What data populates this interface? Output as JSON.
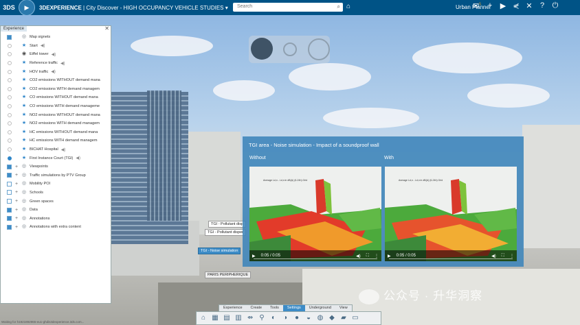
{
  "app": {
    "brand": "3DEXPERIENCE",
    "title_sep": " | ",
    "title": "City Discover - HIGH OCCUPANCY VEHICLE STUDIES",
    "title_chevron": "▾"
  },
  "search": {
    "placeholder": "Search"
  },
  "user": {
    "name": "Urban Planner"
  },
  "notification_count": "5",
  "top_icons": [
    "notification-icon",
    "add-icon",
    "play-icon",
    "share-icon",
    "tools-icon",
    "help-icon",
    "power-icon"
  ],
  "panel": {
    "tab_label": "Experience",
    "rows": [
      {
        "label": "Map signets",
        "check": "on",
        "expander": "",
        "icon": "layer",
        "sound": false
      },
      {
        "label": "Start",
        "check": "radio",
        "expander": "",
        "icon": "star",
        "sound": true
      },
      {
        "label": "Eiffel tower",
        "check": "radio",
        "expander": "",
        "icon": "eye",
        "sound": true
      },
      {
        "label": "Reference traffic",
        "check": "radio",
        "expander": "",
        "icon": "star",
        "sound": true
      },
      {
        "label": "HOV traffic",
        "check": "radio",
        "expander": "",
        "icon": "star",
        "sound": true
      },
      {
        "label": "CO2 emissions WITHOUT demand mana",
        "check": "radio",
        "expander": "",
        "icon": "star",
        "sound": false
      },
      {
        "label": "CO2 emissions WITH demand managem",
        "check": "radio",
        "expander": "",
        "icon": "star",
        "sound": false
      },
      {
        "label": "CO emissions WITHOUT demand mana",
        "check": "radio",
        "expander": "",
        "icon": "star",
        "sound": false
      },
      {
        "label": "CO emissions WITH demand manageme",
        "check": "radio",
        "expander": "",
        "icon": "star",
        "sound": false
      },
      {
        "label": "NO2 emissions WITHOUT demand mana",
        "check": "radio",
        "expander": "",
        "icon": "star",
        "sound": false
      },
      {
        "label": "NO2 emissions WITH demand managem",
        "check": "radio",
        "expander": "",
        "icon": "star",
        "sound": false
      },
      {
        "label": "HC emissions WITHOUT demand mana",
        "check": "radio",
        "expander": "",
        "icon": "star",
        "sound": false
      },
      {
        "label": "HC emissions WITH demand managem",
        "check": "radio",
        "expander": "",
        "icon": "star",
        "sound": false
      },
      {
        "label": "BICHAT Hospital",
        "check": "radio",
        "expander": "",
        "icon": "star",
        "sound": true
      },
      {
        "label": "First Instance Court (TGI)",
        "check": "radio-on",
        "expander": "",
        "icon": "star",
        "sound": true
      },
      {
        "label": "Viewpoints",
        "check": "on",
        "expander": "+",
        "icon": "layer",
        "sound": false
      },
      {
        "label": "Traffic simulations by PTV Group",
        "check": "on",
        "expander": "+",
        "icon": "layer",
        "sound": false
      },
      {
        "label": "Mobility POI",
        "check": "off",
        "expander": "+",
        "icon": "layer",
        "sound": false
      },
      {
        "label": "Schools",
        "check": "off",
        "expander": "+",
        "icon": "layer",
        "sound": false
      },
      {
        "label": "Green spaces",
        "check": "off",
        "expander": "+",
        "icon": "layer",
        "sound": false
      },
      {
        "label": "Data",
        "check": "on",
        "expander": "+",
        "icon": "layer",
        "sound": false
      },
      {
        "label": "Annotations",
        "check": "on",
        "expander": "+",
        "icon": "layer",
        "sound": false
      },
      {
        "label": "Annotations with extra content",
        "check": "on",
        "expander": "+",
        "icon": "layer",
        "sound": false
      }
    ]
  },
  "compare": {
    "title": "TGI area - Noise simulation - Impact of a soundproof wall",
    "left_label": "Without",
    "right_label": "With",
    "left_time": "0:05 / 0:05",
    "right_time": "0:05 / 0:05",
    "legend_text": "Average Ld,n - Ld,n in dB(A) (6-24h) Grid"
  },
  "scene_labels": [
    {
      "text": "TGI - Pollutant disp"
    },
    {
      "text": "TGI - Pollutant disper"
    },
    {
      "text": "TGI - Noise simulation"
    },
    {
      "text": "PARIS PERIPHERIQUE"
    }
  ],
  "bottom_tabs": [
    {
      "label": "Experience",
      "active": false
    },
    {
      "label": "Create",
      "active": false
    },
    {
      "label": "Tools",
      "active": false
    },
    {
      "label": "Settings",
      "active": true
    },
    {
      "label": "Underground",
      "active": false
    },
    {
      "label": "View",
      "active": false
    }
  ],
  "bottom_icons": [
    "home-icon",
    "layers-icon",
    "grid-icon",
    "table-icon",
    "measure-icon",
    "pin-icon",
    "sun-icon",
    "shading-icon",
    "sphere-icon",
    "light-icon",
    "globe-icon",
    "ground-icon",
    "terrain-icon",
    "screen-icon"
  ],
  "status_text": "Waiting for h1921892965-eu1-ghdis3dexperience.3ds.com...",
  "watermark": "公众号 · 升华洞察"
}
